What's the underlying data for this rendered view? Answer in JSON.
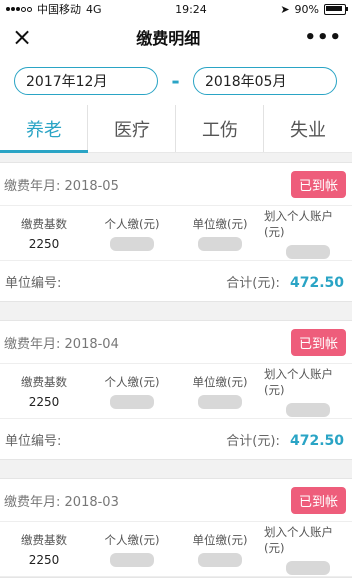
{
  "status_bar": {
    "carrier": "中国移动",
    "network": "4G",
    "time": "19:24",
    "battery": "90%",
    "icons": [
      "signal-icon",
      "location-icon",
      "battery-icon"
    ]
  },
  "nav": {
    "title": "缴费明细",
    "close_icon": "×",
    "more_icon": "•••"
  },
  "date_range": {
    "start": "2017年12月",
    "separator": "-",
    "end": "2018年05月"
  },
  "tabs": [
    {
      "label": "养老",
      "active": true
    },
    {
      "label": "医疗",
      "active": false
    },
    {
      "label": "工伤",
      "active": false
    },
    {
      "label": "失业",
      "active": false
    }
  ],
  "table_headers": [
    "缴费基数",
    "个人缴(元)",
    "单位缴(元)",
    "划入个人账户(元)"
  ],
  "labels": {
    "month_prefix": "缴费年月:",
    "unit_label": "单位编号:",
    "total_label": "合计(元):"
  },
  "records": [
    {
      "month": "2018-05",
      "status": "已到帐",
      "base": "2250",
      "total": "472.50"
    },
    {
      "month": "2018-04",
      "status": "已到帐",
      "base": "2250",
      "total": "472.50"
    },
    {
      "month": "2018-03",
      "status": "已到帐",
      "base": "2250",
      "total": ""
    }
  ],
  "colors": {
    "accent": "#2aa4c5",
    "badge": "#ee5d7b",
    "page_bg": "#f2f2f2"
  }
}
